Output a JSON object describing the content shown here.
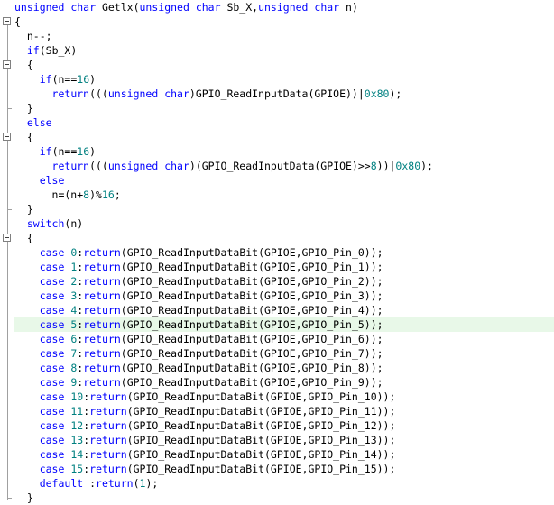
{
  "editor": {
    "lines": [
      {
        "tokens": [
          {
            "t": "unsigned",
            "c": "kw"
          },
          {
            "t": " "
          },
          {
            "t": "char",
            "c": "kw"
          },
          {
            "t": " Getlx("
          },
          {
            "t": "unsigned",
            "c": "kw"
          },
          {
            "t": " "
          },
          {
            "t": "char",
            "c": "kw"
          },
          {
            "t": " Sb_X,"
          },
          {
            "t": "unsigned",
            "c": "kw"
          },
          {
            "t": " "
          },
          {
            "t": "char",
            "c": "kw"
          },
          {
            "t": " n)"
          }
        ]
      },
      {
        "tokens": [
          {
            "t": "{"
          }
        ]
      },
      {
        "tokens": [
          {
            "t": "  n--;"
          }
        ]
      },
      {
        "tokens": [
          {
            "t": "  "
          },
          {
            "t": "if",
            "c": "kw"
          },
          {
            "t": "(Sb_X)"
          }
        ]
      },
      {
        "tokens": [
          {
            "t": "  {"
          }
        ]
      },
      {
        "tokens": [
          {
            "t": "    "
          },
          {
            "t": "if",
            "c": "kw"
          },
          {
            "t": "(n=="
          },
          {
            "t": "16",
            "c": "num"
          },
          {
            "t": ")"
          }
        ]
      },
      {
        "tokens": [
          {
            "t": "      "
          },
          {
            "t": "return",
            "c": "kw"
          },
          {
            "t": "((("
          },
          {
            "t": "unsigned",
            "c": "kw"
          },
          {
            "t": " "
          },
          {
            "t": "char",
            "c": "kw"
          },
          {
            "t": ")GPIO_ReadInputData(GPIOE))|"
          },
          {
            "t": "0x80",
            "c": "num"
          },
          {
            "t": ");"
          }
        ]
      },
      {
        "tokens": [
          {
            "t": "  }"
          }
        ]
      },
      {
        "tokens": [
          {
            "t": "  "
          },
          {
            "t": "else",
            "c": "kw"
          }
        ]
      },
      {
        "tokens": [
          {
            "t": "  {"
          }
        ]
      },
      {
        "tokens": [
          {
            "t": "    "
          },
          {
            "t": "if",
            "c": "kw"
          },
          {
            "t": "(n=="
          },
          {
            "t": "16",
            "c": "num"
          },
          {
            "t": ")"
          }
        ]
      },
      {
        "tokens": [
          {
            "t": "      "
          },
          {
            "t": "return",
            "c": "kw"
          },
          {
            "t": "((("
          },
          {
            "t": "unsigned",
            "c": "kw"
          },
          {
            "t": " "
          },
          {
            "t": "char",
            "c": "kw"
          },
          {
            "t": ")(GPIO_ReadInputData(GPIOE)>>"
          },
          {
            "t": "8",
            "c": "num"
          },
          {
            "t": "))|"
          },
          {
            "t": "0x80",
            "c": "num"
          },
          {
            "t": ");"
          }
        ]
      },
      {
        "tokens": [
          {
            "t": "    "
          },
          {
            "t": "else",
            "c": "kw"
          }
        ]
      },
      {
        "tokens": [
          {
            "t": "      n=(n+"
          },
          {
            "t": "8",
            "c": "num"
          },
          {
            "t": ")%"
          },
          {
            "t": "16",
            "c": "num"
          },
          {
            "t": ";"
          }
        ]
      },
      {
        "tokens": [
          {
            "t": "  }"
          }
        ]
      },
      {
        "tokens": [
          {
            "t": "  "
          },
          {
            "t": "switch",
            "c": "kw"
          },
          {
            "t": "(n)"
          }
        ]
      },
      {
        "tokens": [
          {
            "t": "  {"
          }
        ]
      },
      {
        "tokens": [
          {
            "t": "    "
          },
          {
            "t": "case",
            "c": "kw"
          },
          {
            "t": " "
          },
          {
            "t": "0",
            "c": "num"
          },
          {
            "t": ":"
          },
          {
            "t": "return",
            "c": "kw"
          },
          {
            "t": "(GPIO_ReadInputDataBit(GPIOE,GPIO_Pin_0));"
          }
        ]
      },
      {
        "tokens": [
          {
            "t": "    "
          },
          {
            "t": "case",
            "c": "kw"
          },
          {
            "t": " "
          },
          {
            "t": "1",
            "c": "num"
          },
          {
            "t": ":"
          },
          {
            "t": "return",
            "c": "kw"
          },
          {
            "t": "(GPIO_ReadInputDataBit(GPIOE,GPIO_Pin_1));"
          }
        ]
      },
      {
        "tokens": [
          {
            "t": "    "
          },
          {
            "t": "case",
            "c": "kw"
          },
          {
            "t": " "
          },
          {
            "t": "2",
            "c": "num"
          },
          {
            "t": ":"
          },
          {
            "t": "return",
            "c": "kw"
          },
          {
            "t": "(GPIO_ReadInputDataBit(GPIOE,GPIO_Pin_2));"
          }
        ]
      },
      {
        "tokens": [
          {
            "t": "    "
          },
          {
            "t": "case",
            "c": "kw"
          },
          {
            "t": " "
          },
          {
            "t": "3",
            "c": "num"
          },
          {
            "t": ":"
          },
          {
            "t": "return",
            "c": "kw"
          },
          {
            "t": "(GPIO_ReadInputDataBit(GPIOE,GPIO_Pin_3));"
          }
        ]
      },
      {
        "tokens": [
          {
            "t": "    "
          },
          {
            "t": "case",
            "c": "kw"
          },
          {
            "t": " "
          },
          {
            "t": "4",
            "c": "num"
          },
          {
            "t": ":"
          },
          {
            "t": "return",
            "c": "kw"
          },
          {
            "t": "(GPIO_ReadInputDataBit(GPIOE,GPIO_Pin_4));"
          }
        ]
      },
      {
        "hl": true,
        "tokens": [
          {
            "t": "    "
          },
          {
            "t": "case",
            "c": "kw"
          },
          {
            "t": " "
          },
          {
            "t": "5",
            "c": "num"
          },
          {
            "t": ":"
          },
          {
            "t": "return",
            "c": "kw"
          },
          {
            "t": "(GPIO_ReadInputDataBit(GPIOE,GPIO_Pin_5));"
          }
        ]
      },
      {
        "tokens": [
          {
            "t": "    "
          },
          {
            "t": "case",
            "c": "kw"
          },
          {
            "t": " "
          },
          {
            "t": "6",
            "c": "num"
          },
          {
            "t": ":"
          },
          {
            "t": "return",
            "c": "kw"
          },
          {
            "t": "(GPIO_ReadInputDataBit(GPIOE,GPIO_Pin_6));"
          }
        ]
      },
      {
        "tokens": [
          {
            "t": "    "
          },
          {
            "t": "case",
            "c": "kw"
          },
          {
            "t": " "
          },
          {
            "t": "7",
            "c": "num"
          },
          {
            "t": ":"
          },
          {
            "t": "return",
            "c": "kw"
          },
          {
            "t": "(GPIO_ReadInputDataBit(GPIOE,GPIO_Pin_7));"
          }
        ]
      },
      {
        "tokens": [
          {
            "t": "    "
          },
          {
            "t": "case",
            "c": "kw"
          },
          {
            "t": " "
          },
          {
            "t": "8",
            "c": "num"
          },
          {
            "t": ":"
          },
          {
            "t": "return",
            "c": "kw"
          },
          {
            "t": "(GPIO_ReadInputDataBit(GPIOE,GPIO_Pin_8));"
          }
        ]
      },
      {
        "tokens": [
          {
            "t": "    "
          },
          {
            "t": "case",
            "c": "kw"
          },
          {
            "t": " "
          },
          {
            "t": "9",
            "c": "num"
          },
          {
            "t": ":"
          },
          {
            "t": "return",
            "c": "kw"
          },
          {
            "t": "(GPIO_ReadInputDataBit(GPIOE,GPIO_Pin_9));"
          }
        ]
      },
      {
        "tokens": [
          {
            "t": "    "
          },
          {
            "t": "case",
            "c": "kw"
          },
          {
            "t": " "
          },
          {
            "t": "10",
            "c": "num"
          },
          {
            "t": ":"
          },
          {
            "t": "return",
            "c": "kw"
          },
          {
            "t": "(GPIO_ReadInputDataBit(GPIOE,GPIO_Pin_10));"
          }
        ]
      },
      {
        "tokens": [
          {
            "t": "    "
          },
          {
            "t": "case",
            "c": "kw"
          },
          {
            "t": " "
          },
          {
            "t": "11",
            "c": "num"
          },
          {
            "t": ":"
          },
          {
            "t": "return",
            "c": "kw"
          },
          {
            "t": "(GPIO_ReadInputDataBit(GPIOE,GPIO_Pin_11));"
          }
        ]
      },
      {
        "tokens": [
          {
            "t": "    "
          },
          {
            "t": "case",
            "c": "kw"
          },
          {
            "t": " "
          },
          {
            "t": "12",
            "c": "num"
          },
          {
            "t": ":"
          },
          {
            "t": "return",
            "c": "kw"
          },
          {
            "t": "(GPIO_ReadInputDataBit(GPIOE,GPIO_Pin_12));"
          }
        ]
      },
      {
        "tokens": [
          {
            "t": "    "
          },
          {
            "t": "case",
            "c": "kw"
          },
          {
            "t": " "
          },
          {
            "t": "13",
            "c": "num"
          },
          {
            "t": ":"
          },
          {
            "t": "return",
            "c": "kw"
          },
          {
            "t": "(GPIO_ReadInputDataBit(GPIOE,GPIO_Pin_13));"
          }
        ]
      },
      {
        "tokens": [
          {
            "t": "    "
          },
          {
            "t": "case",
            "c": "kw"
          },
          {
            "t": " "
          },
          {
            "t": "14",
            "c": "num"
          },
          {
            "t": ":"
          },
          {
            "t": "return",
            "c": "kw"
          },
          {
            "t": "(GPIO_ReadInputDataBit(GPIOE,GPIO_Pin_14));"
          }
        ]
      },
      {
        "tokens": [
          {
            "t": "    "
          },
          {
            "t": "case",
            "c": "kw"
          },
          {
            "t": " "
          },
          {
            "t": "15",
            "c": "num"
          },
          {
            "t": ":"
          },
          {
            "t": "return",
            "c": "kw"
          },
          {
            "t": "(GPIO_ReadInputDataBit(GPIOE,GPIO_Pin_15));"
          }
        ]
      },
      {
        "tokens": [
          {
            "t": "    "
          },
          {
            "t": "default",
            "c": "kw"
          },
          {
            "t": " :"
          },
          {
            "t": "return",
            "c": "kw"
          },
          {
            "t": "("
          },
          {
            "t": "1",
            "c": "num"
          },
          {
            "t": ");"
          }
        ]
      },
      {
        "tokens": [
          {
            "t": "  }"
          }
        ]
      }
    ],
    "colors": {
      "keyword": "#0000ff",
      "number": "#008080",
      "highlight": "#e8f8e8"
    }
  }
}
